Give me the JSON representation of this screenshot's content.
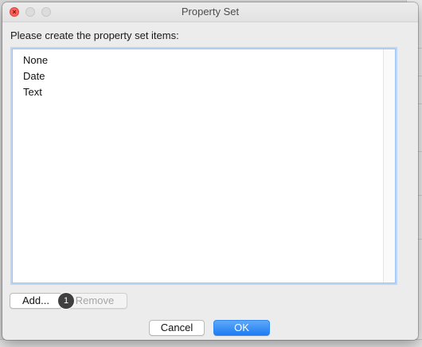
{
  "window": {
    "title": "Property Set"
  },
  "prompt": "Please create the property set items:",
  "list": {
    "items": [
      "None",
      "Date",
      "Text"
    ]
  },
  "buttons": {
    "add": "Add...",
    "remove": "Remove",
    "cancel": "Cancel",
    "ok": "OK"
  },
  "step_badge": "1",
  "colors": {
    "accent": "#2f86f5",
    "close": "#fc605c"
  }
}
